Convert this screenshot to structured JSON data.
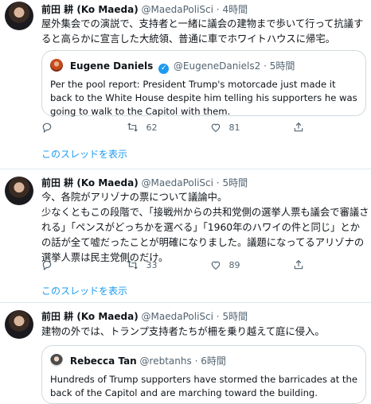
{
  "tweets": [
    {
      "name": "前田 耕 (Ko Maeda)",
      "handle": "@MaedaPoliSci",
      "separator": "·",
      "time": "4時間",
      "text": "屋外集会での演説で、支持者と一緒に議会の建物まで歩いて行って抗議すると高らかに宣言した大統領、普通に車でホワイトハウスに帰宅。",
      "quote": {
        "name": "Eugene Daniels",
        "handle": "@EugeneDaniels2",
        "separator": "·",
        "time": "5時間",
        "verified": true,
        "text": "Per the pool report: President Trump's motorcade just made it back to the White House despite him telling his supporters he was going to walk to the Capitol with them."
      },
      "reply_count": "",
      "retweet_count": "62",
      "like_count": "81",
      "thread_link": "このスレッドを表示"
    },
    {
      "name": "前田 耕 (Ko Maeda)",
      "handle": "@MaedaPoliSci",
      "separator": "·",
      "time": "5時間",
      "text": "今、各院がアリゾナの票について議論中。\n少なくともこの段階で、「接戦州からの共和党側の選挙人票も議会で審議される」「ペンスがどっちかを選べる」「1960年のハワイの件と同じ」とかの話が全て嘘だったことが明確になりました。議題になってるアリゾナの選挙人票は民主党側のだけ。",
      "reply_count": "",
      "retweet_count": "33",
      "like_count": "89",
      "thread_link": "このスレッドを表示"
    },
    {
      "name": "前田 耕 (Ko Maeda)",
      "handle": "@MaedaPoliSci",
      "separator": "·",
      "time": "5時間",
      "text": "建物の外では、トランプ支持者たちが柵を乗り越えて庭に侵入。",
      "quote": {
        "name": "Rebecca Tan",
        "handle": "@rebtanhs",
        "separator": "·",
        "time": "6時間",
        "verified": false,
        "text": "Hundreds of Trump supporters have stormed the barricades at the back of the Capitol and are marching toward the building."
      }
    }
  ],
  "icons": {
    "reply": "reply-icon",
    "retweet": "retweet-icon",
    "like": "like-icon",
    "share": "share-icon",
    "verified": "verified-badge-icon"
  },
  "colors": {
    "link": "#1d9bf0",
    "muted": "#536471",
    "border": "#cfd9de"
  }
}
